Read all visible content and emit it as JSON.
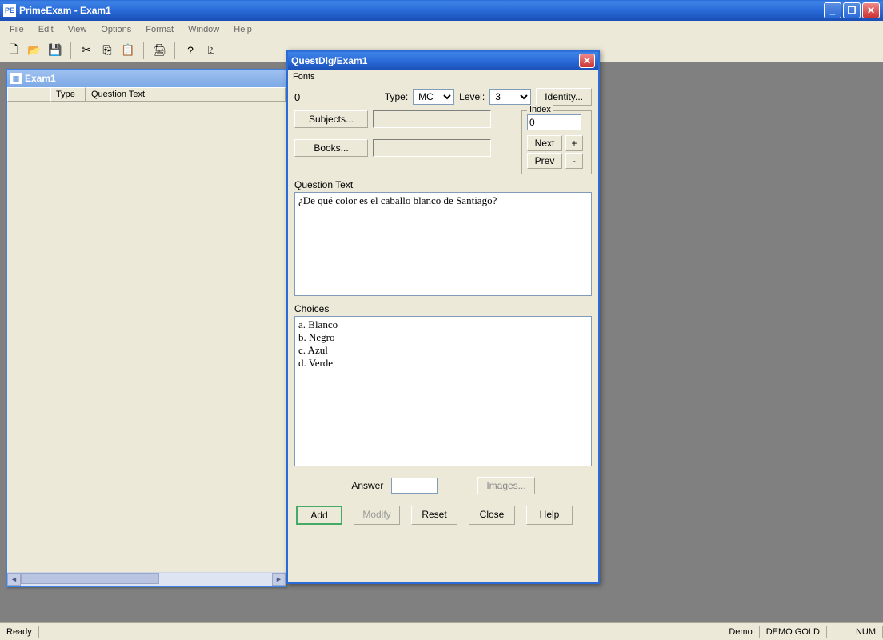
{
  "window": {
    "title": "PrimeExam - Exam1",
    "icon_label": "PE"
  },
  "menus": [
    "File",
    "Edit",
    "View",
    "Options",
    "Format",
    "Window",
    "Help"
  ],
  "child": {
    "title": "Exam1",
    "columns": {
      "type": "Type",
      "qtext": "Question Text"
    }
  },
  "dialog": {
    "title": "QuestDlg/Exam1",
    "menu": "Fonts",
    "number": "0",
    "type_label": "Type:",
    "type_value": "MC",
    "level_label": "Level:",
    "level_value": "3",
    "identity_btn": "Identity...",
    "subjects_btn": "Subjects...",
    "books_btn": "Books...",
    "index": {
      "legend": "Index",
      "value": "0",
      "next": "Next",
      "prev": "Prev",
      "plus": "+",
      "minus": "-"
    },
    "qtext_label": "Question Text",
    "qtext_value": "¿De qué color es el caballo blanco de Santiago?",
    "choices_label": "Choices",
    "choices_value": "a. Blanco\nb. Negro\nc. Azul\nd. Verde",
    "answer_label": "Answer",
    "answer_value": "",
    "images_btn": "Images...",
    "buttons": {
      "add": "Add",
      "modify": "Modify",
      "reset": "Reset",
      "close": "Close",
      "help": "Help"
    }
  },
  "status": {
    "ready": "Ready",
    "demo": "Demo",
    "demogold": "DEMO GOLD",
    "num": "NUM"
  }
}
